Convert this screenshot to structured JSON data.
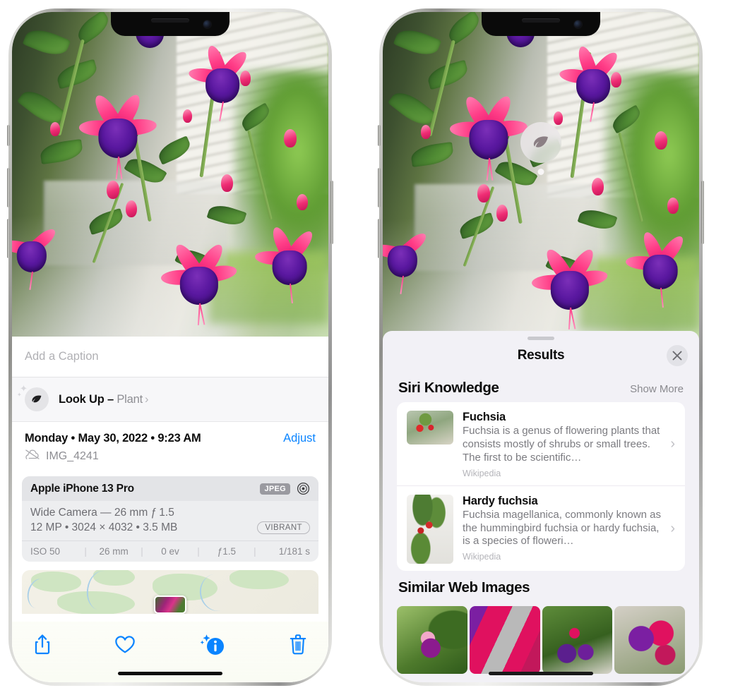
{
  "left_phone": {
    "photo": {
      "alt": "fuchsia-flowers-photo"
    },
    "caption_field": {
      "placeholder": "Add a Caption",
      "value": ""
    },
    "look_up": {
      "icon": "leaf-icon",
      "label": "Look Up",
      "dash": "–",
      "subject": "Plant",
      "chevron": "›"
    },
    "metadata": {
      "date_line": "Monday • May 30, 2022 • 9:23 AM",
      "adjust_label": "Adjust",
      "cloud_icon": "icloud-slash-icon",
      "filename": "IMG_4241"
    },
    "exif": {
      "model": "Apple iPhone 13 Pro",
      "format_badge": "JPEG",
      "aperture_icon": "aperture-icon",
      "lens_line": "Wide Camera — 26 mm ƒ 1.5",
      "size_line": "12 MP • 3024 × 4032 • 3.5 MB",
      "style_badge": "VIBRANT",
      "stats": [
        {
          "label": "ISO 50"
        },
        {
          "label": "26 mm"
        },
        {
          "label": "0 ev"
        },
        {
          "label": "ƒ1.5"
        },
        {
          "label": "1/181 s"
        }
      ]
    },
    "map": {
      "alt": "location-map-thumbnail"
    },
    "toolbar": [
      {
        "name": "share-button",
        "icon": "share-icon",
        "active": false
      },
      {
        "name": "favorite-button",
        "icon": "heart-icon",
        "active": false
      },
      {
        "name": "info-button",
        "icon": "info-sparkle-icon",
        "active": true
      },
      {
        "name": "delete-button",
        "icon": "trash-icon",
        "active": false
      }
    ]
  },
  "right_phone": {
    "visual_lookup_badge": {
      "icon": "leaf-icon"
    },
    "results_panel": {
      "title": "Results",
      "close_icon": "close-icon",
      "sections": [
        {
          "title": "Siri Knowledge",
          "action": "Show More",
          "cards": [
            {
              "title": "Fuchsia",
              "description": "Fuchsia is a genus of flowering plants that consists mostly of shrubs or small trees. The first to be scientific…",
              "source": "Wikipedia",
              "thumb": "fuchsia-red-flowers-thumb",
              "chevron": "›"
            },
            {
              "title": "Hardy fuchsia",
              "description": "Fuchsia magellanica, commonly known as the hummingbird fuchsia or hardy fuchsia, is a species of floweri…",
              "source": "Wikipedia",
              "thumb": "hardy-fuchsia-specimen-thumb",
              "chevron": "›"
            }
          ]
        },
        {
          "title": "Similar Web Images",
          "images": [
            {
              "alt": "pink-purple-fuchsia-web-image-1"
            },
            {
              "alt": "red-fuchsia-closeup-web-image-2"
            },
            {
              "alt": "fuchsia-bush-web-image-3"
            },
            {
              "alt": "purple-red-fuchsia-web-image-4"
            }
          ]
        }
      ]
    }
  },
  "colors": {
    "accent_blue": "#0a84ff",
    "panel_bg": "#f2f1f6",
    "card_bg": "#ffffff",
    "secondary_text": "#8e8e93"
  }
}
